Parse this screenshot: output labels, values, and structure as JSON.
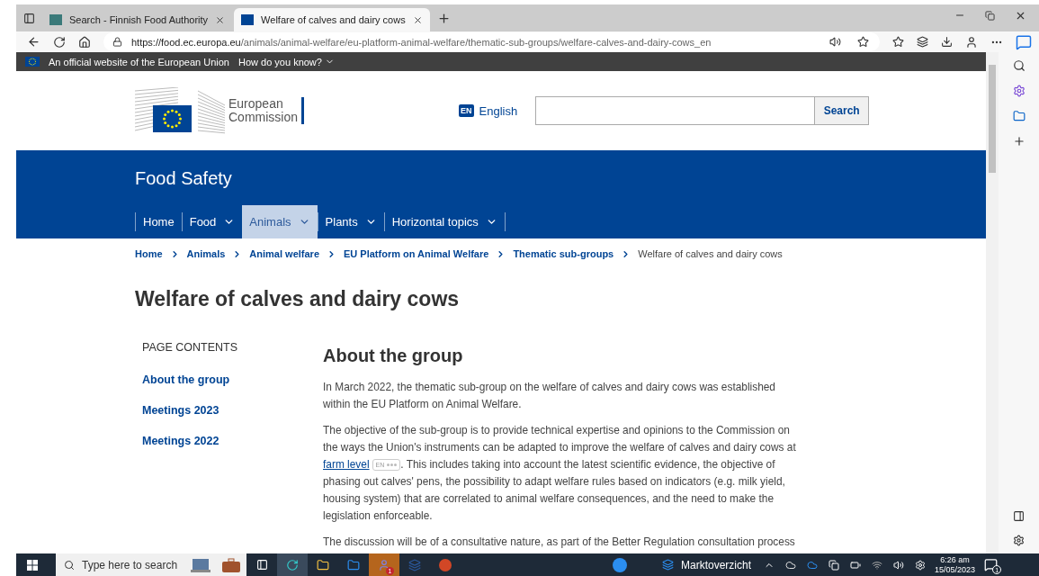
{
  "browser": {
    "tabs": [
      {
        "title": "Search - Finnish Food Authority",
        "selected": false
      },
      {
        "title": "Welfare of calves and dairy cows",
        "selected": true
      }
    ],
    "url_host": "https://food.ec.europa.eu",
    "url_path": "/animals/animal-welfare/eu-platform-animal-welfare/thematic-sub-groups/welfare-calves-and-dairy-cows_en"
  },
  "eu_bar": {
    "text": "An official website of the European Union",
    "link": "How do you know?"
  },
  "header": {
    "logo_line1": "European",
    "logo_line2": "Commission",
    "language_code": "EN",
    "language": "English",
    "search_button": "Search"
  },
  "site_title": "Food Safety",
  "nav": [
    {
      "label": "Home",
      "dropdown": false,
      "selected": false
    },
    {
      "label": "Food",
      "dropdown": true,
      "selected": false
    },
    {
      "label": "Animals",
      "dropdown": true,
      "selected": true
    },
    {
      "label": "Plants",
      "dropdown": true,
      "selected": false
    },
    {
      "label": "Horizontal topics",
      "dropdown": true,
      "selected": false
    }
  ],
  "breadcrumb": [
    "Home",
    "Animals",
    "Animal welfare",
    "EU Platform on Animal Welfare",
    "Thematic sub-groups",
    "Welfare of calves and dairy cows"
  ],
  "page_title": "Welfare of calves and dairy cows",
  "page_contents": {
    "heading": "PAGE CONTENTS",
    "items": [
      "About the group",
      "Meetings 2023",
      "Meetings 2022"
    ]
  },
  "section": {
    "heading": "About the group",
    "paragraphs": [
      {
        "text": "In March 2022, the thematic sub-group on the welfare of calves and dairy cows was established within the EU Platform on Animal Welfare."
      },
      {
        "text": "The objective of the sub-group is to provide technical expertise and opinions to the Commission on the ways the Union's instruments can be adapted to improve the welfare of calves and dairy cows at ",
        "link": "farm level",
        "badge": "EN",
        "after": ". This includes taking into account the latest scientific evidence, the objective of phasing out calves' pens, the possibility to adapt welfare rules based on indicators (e.g. milk yield, housing system) that are correlated to animal welfare consequences, and the need to make the legislation enforceable."
      },
      {
        "text": "The discussion will be of a consultative nature, as part of the Better Regulation consultation process"
      }
    ]
  },
  "taskbar": {
    "search_placeholder": "Type here to search",
    "teams_badge": "1",
    "widget": "Marktoverzicht",
    "time": "6:26 am",
    "date": "15/05/2023",
    "notification_count": "1"
  }
}
